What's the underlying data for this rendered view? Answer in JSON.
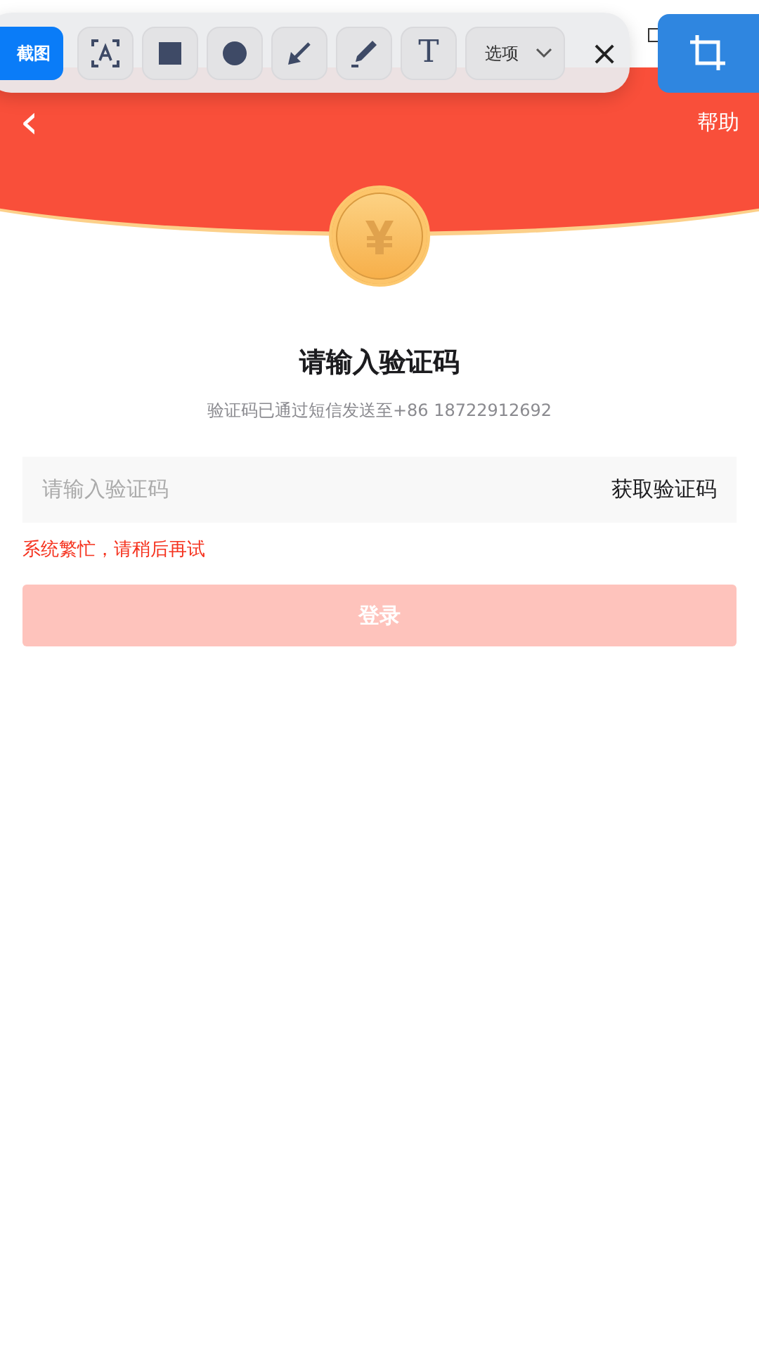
{
  "capture_toolbar": {
    "capture_label": "截图",
    "tools": [
      {
        "kind": "ocr"
      },
      {
        "kind": "rect"
      },
      {
        "kind": "circle"
      },
      {
        "kind": "arrow"
      },
      {
        "kind": "pen"
      },
      {
        "kind": "text",
        "glyph": "T"
      }
    ],
    "options_label": "选项",
    "close_glyph": "×"
  },
  "header": {
    "back_glyph": "‹",
    "help": "帮助"
  },
  "title": "请输入验证码",
  "subtitle": "验证码已通过短信发送至+86 18722912692",
  "code_field": {
    "placeholder": "请输入验证码",
    "action": "获取验证码"
  },
  "error": "系统繁忙，请稍后再试",
  "login_button": {
    "label": "登录",
    "disabled": true
  }
}
